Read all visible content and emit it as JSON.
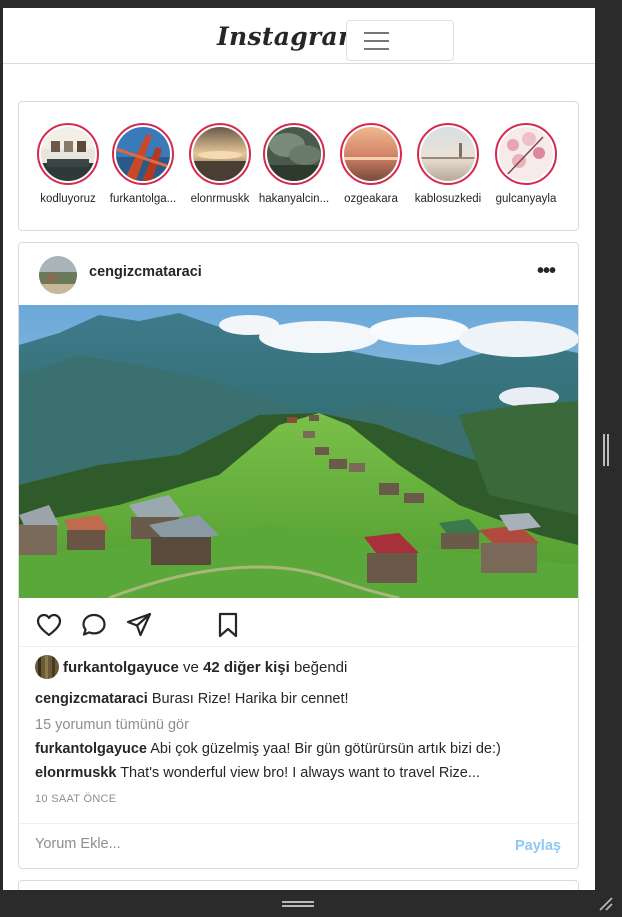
{
  "navbar": {
    "logo": "Instagram",
    "menu_icon": "hamburger-icon"
  },
  "stories": [
    {
      "name": "kodluyoruz"
    },
    {
      "name": "furkantolga..."
    },
    {
      "name": "elonrmuskk"
    },
    {
      "name": "hakanyalcin..."
    },
    {
      "name": "ozgeakara"
    },
    {
      "name": "kablosuzkedi"
    },
    {
      "name": "gulcanyayla"
    }
  ],
  "post": {
    "username": "cengizcmataraci",
    "more_icon": "more-options-icon",
    "action_icons": [
      "heart-icon",
      "comment-icon",
      "share-icon",
      "bookmark-icon"
    ],
    "likes": {
      "liker": "furkantolgayuce",
      "connector": "ve",
      "others": "42 diğer kişi",
      "suffix": "beğendi"
    },
    "caption": {
      "user": "cengizcmataraci",
      "text": "Burası Rize! Harika bir cennet!"
    },
    "view_all_comments": "15 yorumun tümünü gör",
    "comments": [
      {
        "user": "furkantolgayuce",
        "text": "Abi çok güzelmiş yaa! Bir gün götürürsün artık bizi de:)"
      },
      {
        "user": "elonrmuskk",
        "text": "That's wonderful view bro! I always want to travel Rize..."
      }
    ],
    "time": "10 SAAT ÖNCE",
    "comment_placeholder": "Yorum Ekle...",
    "share_label": "Paylaş"
  },
  "colors": {
    "story_ring": "#d6294d",
    "share_link": "#8cc8f3",
    "border": "#dbdbdb"
  }
}
